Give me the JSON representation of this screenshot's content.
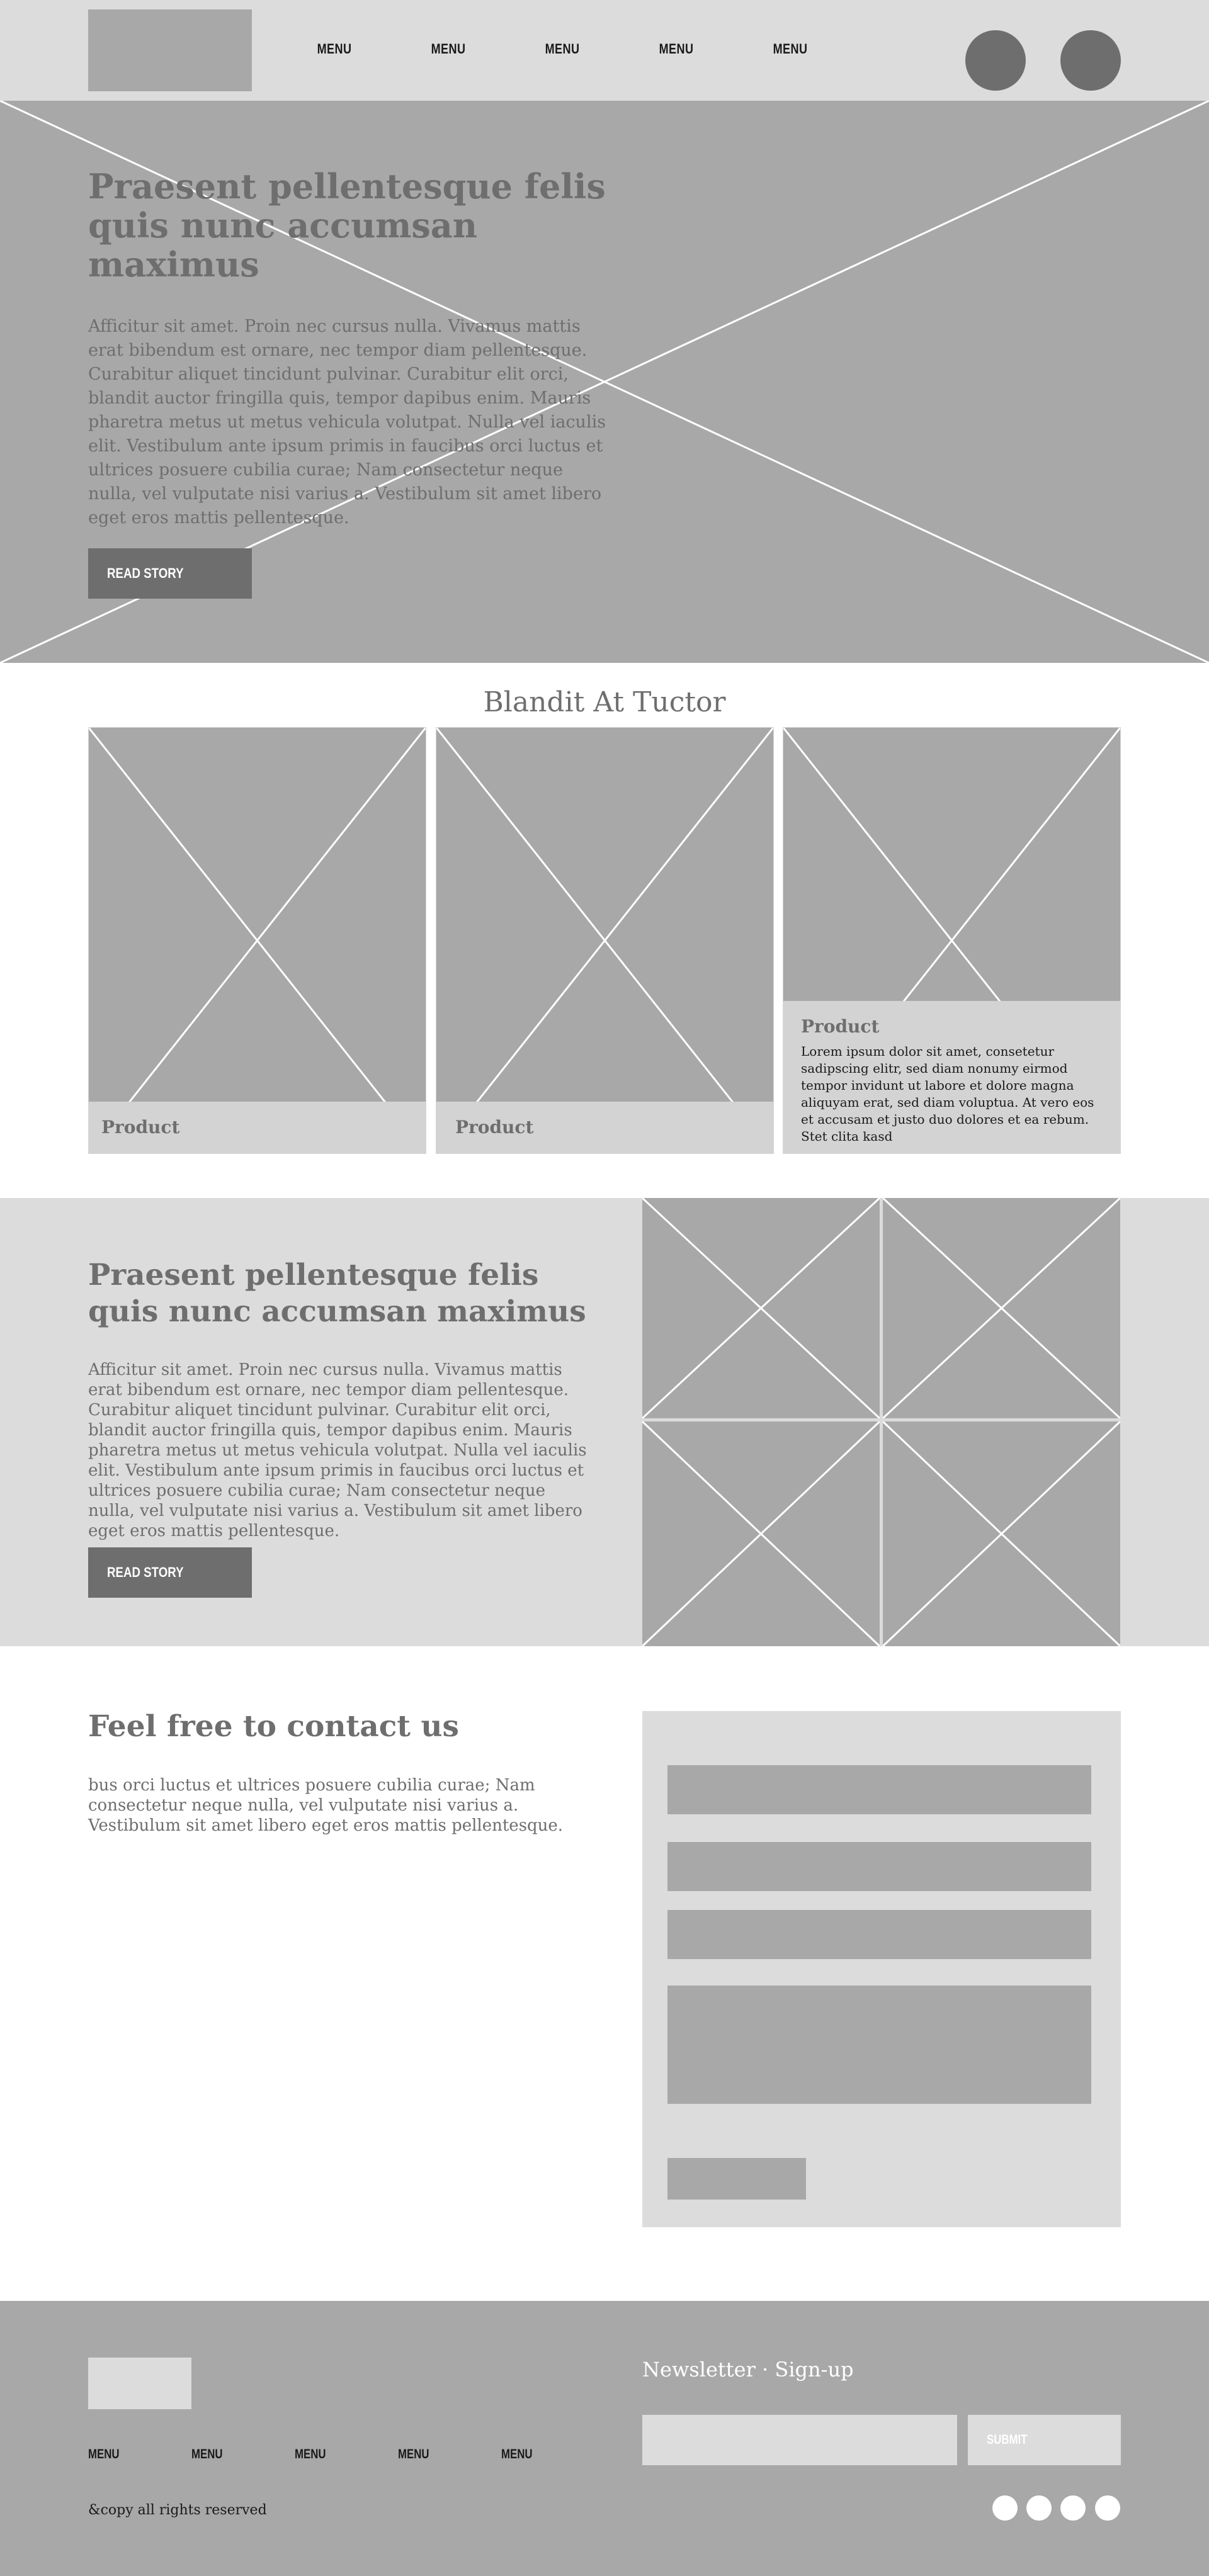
{
  "header": {
    "nav": [
      "MENU",
      "MENU",
      "MENU",
      "MENU",
      "MENU"
    ]
  },
  "hero": {
    "title": "Praesent pellentesque felis quis nunc accumsan maximus",
    "body": "Afficitur sit amet. Proin nec cursus nulla. Vivamus mattis erat bibendum est ornare, nec tempor diam pellentesque. Curabitur aliquet tincidunt pulvinar. Curabitur elit orci, blandit auctor fringilla quis, tempor dapibus enim. Mauris pharetra metus ut metus vehicula volutpat. Nulla vel iaculis elit. Vestibulum ante ipsum primis in faucibus orci luctus et ultrices posuere cubilia curae; Nam consectetur neque nulla, vel vulputate nisi varius a. Vestibulum sit amet libero eget eros mattis pellentesque.",
    "button": "READ STORY"
  },
  "products": {
    "title": "Blandit At Tuctor",
    "items": [
      {
        "label": "Product",
        "desc": ""
      },
      {
        "label": "Product",
        "desc": ""
      },
      {
        "label": "Product",
        "desc": "Lorem ipsum dolor sit amet, consetetur sadipscing elitr, sed diam nonumy eirmod tempor invidunt ut labore et dolore magna aliquyam erat, sed diam voluptua. At vero eos et accusam et justo duo dolores et ea rebum. Stet clita kasd"
      }
    ]
  },
  "feature": {
    "title": "Praesent pellentesque felis quis nunc accumsan maximus",
    "body": "Afficitur sit amet. Proin nec cursus nulla. Vivamus mattis erat bibendum est ornare, nec tempor diam pellentesque. Curabitur aliquet tincidunt pulvinar. Curabitur elit orci, blandit auctor fringilla quis, tempor dapibus enim. Mauris pharetra metus ut metus vehicula volutpat. Nulla vel iaculis elit. Vestibulum ante ipsum primis in faucibus orci luctus et ultrices posuere cubilia curae; Nam consectetur neque nulla, vel vulputate nisi varius a. Vestibulum sit amet libero eget eros mattis pellentesque.",
    "button": "READ STORY"
  },
  "contact": {
    "title": "Feel free to contact us",
    "body": "bus orci luctus et ultrices posuere cubilia curae; Nam consectetur neque nulla, vel vulputate nisi varius a. Vestibulum sit amet libero eget eros mattis pellentesque."
  },
  "footer": {
    "nav": [
      "MENU",
      "MENU",
      "MENU",
      "MENU",
      "MENU"
    ],
    "copyright": "&copy all rights reserved",
    "newsletter_title": "Newsletter · Sign-up",
    "submit": "SUBMIT"
  },
  "colors": {
    "placeholder": "#a8a8a8",
    "light_bg": "#dcdcdc",
    "dark": "#6e6e6e",
    "text_dark": "#1a1a1a"
  }
}
